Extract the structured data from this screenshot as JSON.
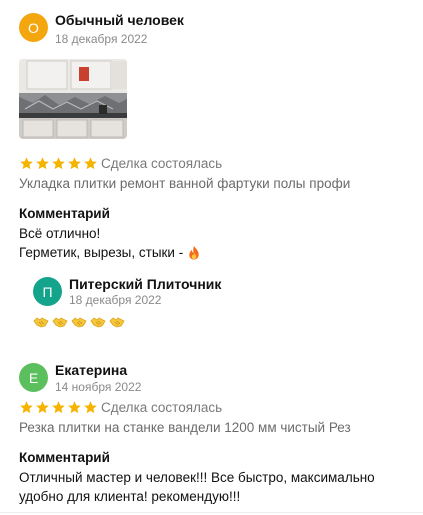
{
  "reviews": [
    {
      "author": "Обычный человек",
      "initial": "О",
      "avatar_color": "#f4a60f",
      "date": "18 декабря 2022",
      "rating": 5,
      "deal_status": "Сделка состоялась",
      "service": "Укладка плитки ремонт ванной фартуки полы профи",
      "comment_title": "Комментарий",
      "comment_lines": [
        "Всё отлично!",
        "Герметик, вырезы, стыки -"
      ],
      "reply": {
        "author": "Питерский Плиточник",
        "initial": "П",
        "avatar_color": "#14a38b",
        "date": "18 декабря 2022"
      }
    },
    {
      "author": "Екатерина",
      "initial": "Е",
      "avatar_color": "#5bbf5d",
      "date": "14 ноября 2022",
      "rating": 5,
      "deal_status": "Сделка состоялась",
      "service": "Резка плитки на станке вандели 1200 мм чистый Рез",
      "comment_title": "Комментарий",
      "comment_lines": [
        "Отличный мастер и человек!!! Все быстро, максимально",
        "удобно для клиента! рекомендую!!!"
      ]
    }
  ],
  "colors": {
    "star": "#f5b400",
    "muted": "#8a8a8a"
  },
  "icons": {
    "star": "star-icon",
    "fire": "fire-icon",
    "handshake": "handshake-icon"
  }
}
